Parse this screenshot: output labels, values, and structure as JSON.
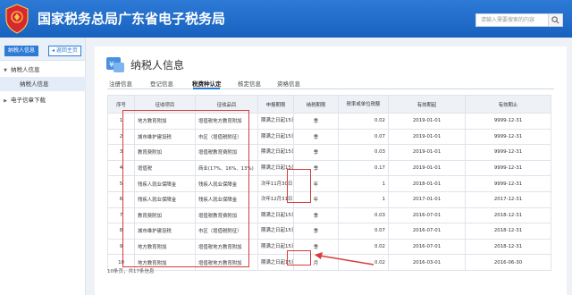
{
  "header": {
    "emblem_text": "中国税务",
    "title": "国家税务总局广东省电子税务局",
    "search_placeholder": "请输入需要搜索的内容"
  },
  "sidebar": {
    "tab_label": "纳税人信息",
    "back_label": "◂ 返回主页",
    "items": [
      {
        "label": "纳税人信息",
        "expanded": true
      },
      {
        "label": "纳税人信息",
        "sub": true
      },
      {
        "label": "电子信章下载",
        "expanded": false
      }
    ]
  },
  "page": {
    "title": "纳税人信息",
    "tabs": [
      "注册信息",
      "登记信息",
      "税费种认定",
      "核定信息",
      "资格信息"
    ],
    "active_tab": "税费种认定"
  },
  "table": {
    "columns": [
      "序号",
      "征收项目",
      "征收品目",
      "申报期限",
      "纳税期限",
      "税率或单位税额",
      "有效期起",
      "有效期止"
    ],
    "rows": [
      [
        "1",
        "地方教育附加",
        "增值税地方教育附加",
        "期满之日起15日内",
        "季",
        "0.02",
        "2019-01-01",
        "9999-12-31"
      ],
      [
        "2",
        "城市维护建设税",
        "市区（增值税附征）",
        "期满之日起15日内",
        "季",
        "0.07",
        "2019-01-01",
        "9999-12-31"
      ],
      [
        "3",
        "教育费附加",
        "增值税教育费附加",
        "期满之日起15日内",
        "季",
        "0.03",
        "2019-01-01",
        "9999-12-31"
      ],
      [
        "4",
        "增值税",
        "商业(17%、16%、13%)",
        "期满之日起15日内",
        "季",
        "0.17",
        "2019-01-01",
        "9999-12-31"
      ],
      [
        "5",
        "残疾人就业保障金",
        "残疾人就业保障金",
        "次年11月30日",
        "年",
        "1",
        "2018-01-01",
        "9999-12-31"
      ],
      [
        "6",
        "残疾人就业保障金",
        "残疾人就业保障金",
        "次年12月31日",
        "年",
        "1",
        "2017-01-01",
        "2017-12-31"
      ],
      [
        "7",
        "教育费附加",
        "增值税教育费附加",
        "期满之日起15日内",
        "季",
        "0.03",
        "2016-07-01",
        "2018-12-31"
      ],
      [
        "8",
        "城市维护建设税",
        "市区（增值税附征）",
        "期满之日起15日内",
        "季",
        "0.07",
        "2016-07-01",
        "2018-12-31"
      ],
      [
        "9",
        "地方教育附加",
        "增值税地方教育附加",
        "期满之日起15日内",
        "季",
        "0.02",
        "2016-07-01",
        "2018-12-31"
      ],
      [
        "10",
        "地方教育附加",
        "增值税地方教育附加",
        "期满之日起15日内",
        "月",
        "0.02",
        "2016-03-01",
        "2016-06-30"
      ]
    ]
  },
  "footer": {
    "summary": "10条页，共17条信息"
  },
  "colors": {
    "brand": "#1762be",
    "highlight": "#d93a3a"
  }
}
